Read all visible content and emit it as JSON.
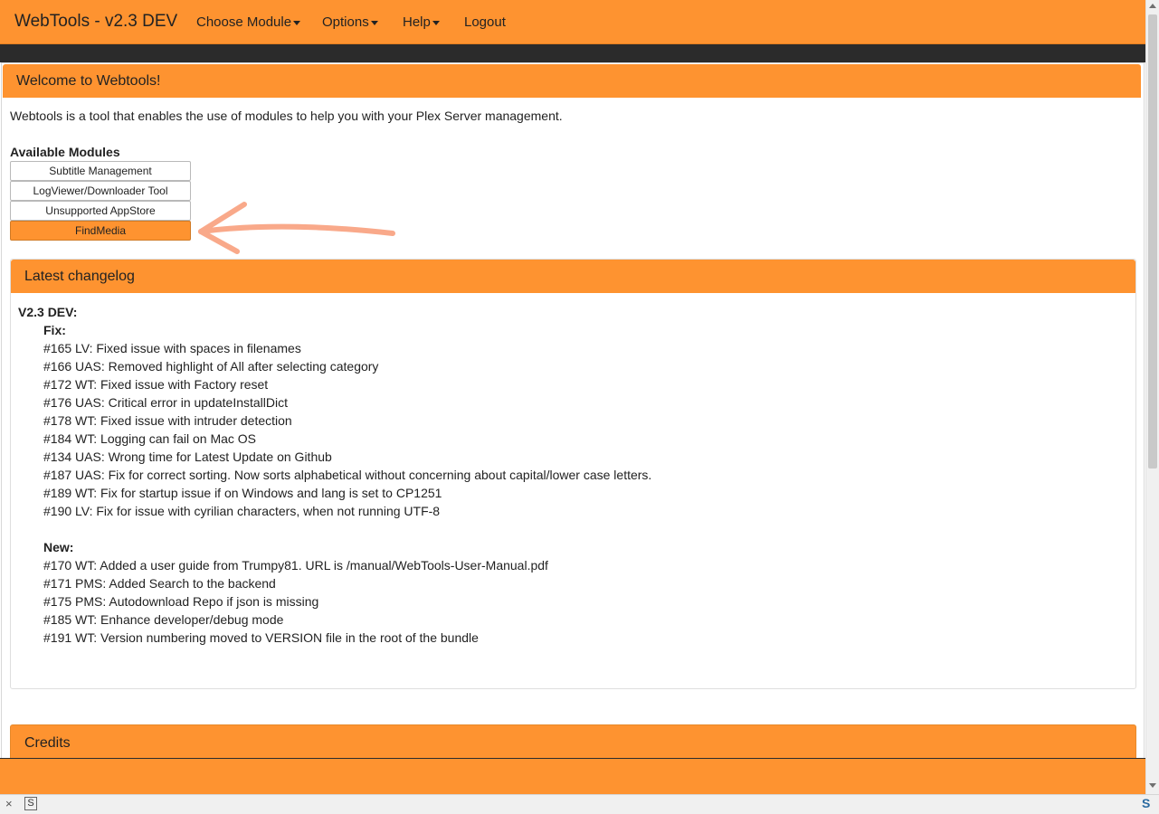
{
  "navbar": {
    "brand": "WebTools - v2.3 DEV",
    "items": [
      {
        "label": "Choose Module",
        "dropdown": true
      },
      {
        "label": "Options",
        "dropdown": true
      },
      {
        "label": "Help",
        "dropdown": true
      },
      {
        "label": "Logout",
        "dropdown": false
      }
    ]
  },
  "welcome": {
    "title": "Welcome to Webtools!",
    "intro": "Webtools is a tool that enables the use of modules to help you with your Plex Server management.",
    "modules_heading": "Available Modules",
    "modules": [
      {
        "label": "Subtitle Management",
        "active": false
      },
      {
        "label": "LogViewer/Downloader Tool",
        "active": false
      },
      {
        "label": "Unsupported AppStore",
        "active": false
      },
      {
        "label": "FindMedia",
        "active": true
      }
    ]
  },
  "changelog": {
    "title": "Latest changelog",
    "version": "V2.3 DEV:",
    "fix_heading": "Fix:",
    "fix": [
      "#165 LV: Fixed issue with spaces in filenames",
      "#166 UAS: Removed highlight of All after selecting category",
      "#172 WT: Fixed issue with Factory reset",
      "#176 UAS: Critical error in updateInstallDict",
      "#178 WT: Fixed issue with intruder detection",
      "#184 WT: Logging can fail on Mac OS",
      "#134 UAS: Wrong time for Latest Update on Github",
      "#187 UAS: Fix for correct sorting. Now sorts alphabetical without concerning about capital/lower case letters.",
      "#189 WT: Fix for startup issue if on Windows and lang is set to CP1251",
      "#190 LV: Fix for issue with cyrilian characters, when not running UTF-8"
    ],
    "new_heading": "New:",
    "new": [
      "#170 WT: Added a user guide from Trumpy81. URL is /manual/WebTools-User-Manual.pdf",
      "#171 PMS: Added Search to the backend",
      "#175 PMS: Autodownload Repo if json is missing",
      "#185 WT: Enhance developer/debug mode",
      "#191 WT: Version numbering moved to VERSION file in the root of the bundle"
    ]
  },
  "credits": {
    "title": "Credits"
  },
  "statusbar": {
    "close_glyph": "×",
    "s_glyph": "S"
  },
  "colors": {
    "accent": "#fe9330",
    "dark": "#2b2b2b",
    "annotation_arrow": "#f9a98a"
  }
}
